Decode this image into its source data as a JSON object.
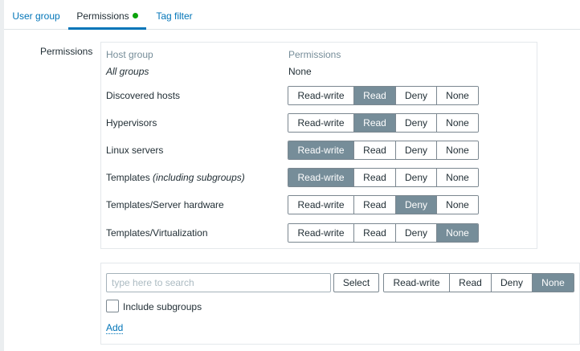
{
  "tabs": [
    {
      "label": "User group"
    },
    {
      "label": "Permissions"
    },
    {
      "label": "Tag filter"
    }
  ],
  "form_label": "Permissions",
  "table": {
    "col_host_group": "Host group",
    "col_permissions": "Permissions",
    "all_groups": {
      "label": "All groups",
      "value": "None"
    },
    "options": [
      "Read-write",
      "Read",
      "Deny",
      "None"
    ],
    "rows": [
      {
        "label": "Discovered hosts",
        "selected": "Read"
      },
      {
        "label": "Hypervisors",
        "selected": "Read"
      },
      {
        "label": "Linux servers",
        "selected": "Read-write"
      },
      {
        "label": "Templates",
        "suffix": "(including subgroups)",
        "selected": "Read-write"
      },
      {
        "label": "Templates/Server hardware",
        "selected": "Deny"
      },
      {
        "label": "Templates/Virtualization",
        "selected": "None"
      }
    ]
  },
  "add_form": {
    "search_placeholder": "type here to search",
    "select_label": "Select",
    "selected": "None",
    "include_subgroups_label": "Include subgroups",
    "add_label": "Add"
  },
  "colors": {
    "accent": "#0275b8",
    "selected_segment": "#768d99",
    "active_dot": "#0ca30c"
  }
}
